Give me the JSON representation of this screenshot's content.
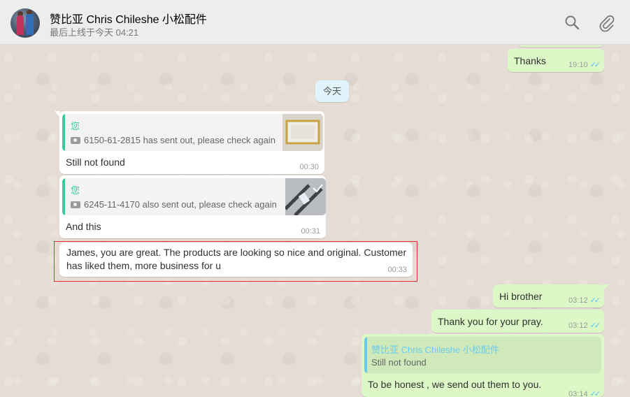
{
  "header": {
    "contact_name": "赞比亚 Chris Chileshe 小松配件",
    "last_seen": "最后上线于今天 04:21",
    "icons": [
      "search-icon",
      "attach-icon"
    ]
  },
  "colors": {
    "header_bg": "#ededed",
    "chat_bg": "#e5ddd5",
    "incoming_bubble": "#ffffff",
    "outgoing_bubble": "#dcf8c6",
    "quote_accent": "#35cd96",
    "read_ticks": "#4fc3f7",
    "highlight_border": "#e0302f"
  },
  "date_separator": "今天",
  "messages": [
    {
      "dir": "out",
      "text": "Thanks",
      "time": "19:10",
      "read": true
    },
    {
      "dir": "in",
      "quote_author": "您",
      "quote_text": "6150-61-2815 has sent out, please check again",
      "text": "Still not found",
      "time": "00:30"
    },
    {
      "dir": "in",
      "quote_author": "您",
      "quote_text": "6245-11-4170 also sent out, please check again",
      "text": "And this",
      "time": "00:31"
    },
    {
      "dir": "in",
      "text_line1": "James, you are great. The products are looking so nice and original. Customer",
      "text_line2": "has liked them, more business for u",
      "time": "00:33",
      "highlighted": true
    },
    {
      "dir": "out",
      "text": "Hi brother",
      "time": "03:12",
      "read": true
    },
    {
      "dir": "out",
      "text": "Thank you for your pray.",
      "time": "03:12",
      "read": true
    },
    {
      "dir": "out",
      "quote_author": "赞比亚 Chris Chileshe 小松配件",
      "quote_text": "Still not found",
      "text": "To be honest , we send out them to you.",
      "time": "03:14",
      "read": true
    }
  ]
}
